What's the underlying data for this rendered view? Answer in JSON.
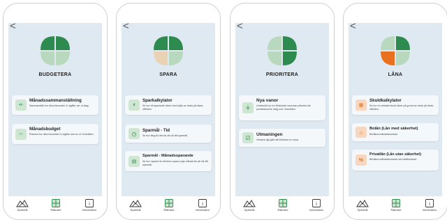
{
  "phones": [
    {
      "title": "BUDGETERA",
      "back_label": "<",
      "cards": [
        {
          "title": "Månadssammanställning",
          "desc": "Sammanställ hur dina inkomster & utgifter ser ut idag.",
          "icon": "plus-minus-icon",
          "glyph": "+/-"
        },
        {
          "title": "Månadsbudget",
          "desc": "Planera hur dina inkomster & utgifter ska se ut i framtiden.",
          "icon": "calendar-arrows-icon",
          "glyph": "‹·›"
        }
      ]
    },
    {
      "title": "SPARA",
      "back_label": "<",
      "cards": [
        {
          "title": "Sparkalkylator",
          "desc": "Se hur ett sparande växer med hjälp av ränta på ränta - effekten.",
          "icon": "bar-chart-icon",
          "glyph": "ıl"
        },
        {
          "title": "Sparmål - Tid",
          "desc": "Se hur lång tid det tar att nå ditt sparmål.",
          "icon": "clock-icon",
          "glyph": "◷"
        },
        {
          "title": "Sparmål - Månadssparande",
          "desc": "Se hur mycket du behöver spara varje månad för att nå ditt sparmål.",
          "icon": "calendar-check-icon",
          "glyph": "▤"
        }
      ]
    },
    {
      "title": "PRIORITERA",
      "back_label": "<",
      "cards": [
        {
          "title": "Nya vanor",
          "desc": "Undersök hur en förändrad vana kan påverka din privatekonomi, idag och i framtiden.",
          "icon": "signpost-icon",
          "glyph": "╪"
        },
        {
          "title": "Utmaningen",
          "desc": "Utmana dig själv att förändra en vana.",
          "icon": "checkbox-icon",
          "glyph": "☑"
        }
      ]
    },
    {
      "title": "LÅNA",
      "back_label": "<",
      "cards": [
        {
          "title": "Skuldkalkylator",
          "desc": "Se hur en obetald skuld växer på grund av ränta på ränta - effekten.",
          "icon": "calculator-icon",
          "glyph": "▦"
        },
        {
          "title": "Bolån (Lån med säkerhet)",
          "desc": "Beräkna månadskostnad.",
          "icon": "house-icon",
          "glyph": "⌂"
        },
        {
          "title": "Privatlån (Lån utan säkerhet)",
          "desc": "Beräkna månadskostnad och totalkostnad.",
          "icon": "percent-icon",
          "glyph": "%"
        }
      ]
    }
  ],
  "tabbar": {
    "tabs": [
      {
        "label": "Sparmål",
        "icon": "mountain-icon"
      },
      {
        "label": "Räknare",
        "icon": "calculator-grid-icon"
      },
      {
        "label": "Information",
        "icon": "info-icon",
        "glyph": "i"
      }
    ]
  },
  "colors": {
    "screen_bg": "#dfe9f2",
    "leaf_dark_green": "#2e8b4f",
    "leaf_light_green": "#b8d9bd",
    "leaf_beige": "#e9d3b4",
    "leaf_orange": "#e8701e",
    "budget_icon_bg": "#cfe6d3",
    "loan_icon_bg": "#f7d7c0"
  }
}
